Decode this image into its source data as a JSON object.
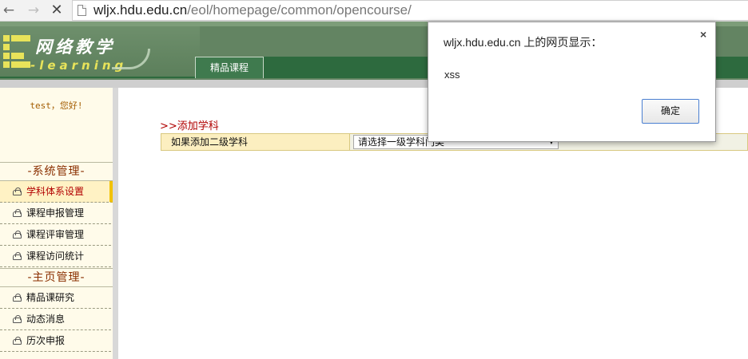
{
  "browser": {
    "url_host": "wljx.hdu.edu.cn",
    "url_path": "/eol/homepage/common/opencourse/",
    "back_icon": "back-arrow-icon",
    "forward_icon": "forward-arrow-icon",
    "reload_icon": "reload-icon"
  },
  "header": {
    "logo_title": "网络教学",
    "logo_subtitle": "-learning",
    "tab_label": "精品课程",
    "colors": {
      "green": "#638462",
      "dark_green": "#2d6a3e",
      "yellow": "#e8e35a"
    }
  },
  "sidebar": {
    "greeting": "test，您好!",
    "sections": [
      {
        "title": "-系统管理-",
        "items": [
          {
            "label": "学科体系设置",
            "active": true
          },
          {
            "label": "课程申报管理",
            "active": false
          },
          {
            "label": "课程评审管理",
            "active": false
          },
          {
            "label": "课程访问统计",
            "active": false
          }
        ]
      },
      {
        "title": "-主页管理-",
        "items": [
          {
            "label": "精品课研究",
            "active": false
          },
          {
            "label": "动态消息",
            "active": false
          },
          {
            "label": "历次申报",
            "active": false
          }
        ]
      }
    ]
  },
  "main": {
    "title": ">>添加学科",
    "form": {
      "label": "如果添加二级学科",
      "select_value": "请选择一级学科门类"
    }
  },
  "dialog": {
    "title": "wljx.hdu.edu.cn 上的网页显示：",
    "message": "xss",
    "ok_label": "确定",
    "close_label": "×"
  }
}
